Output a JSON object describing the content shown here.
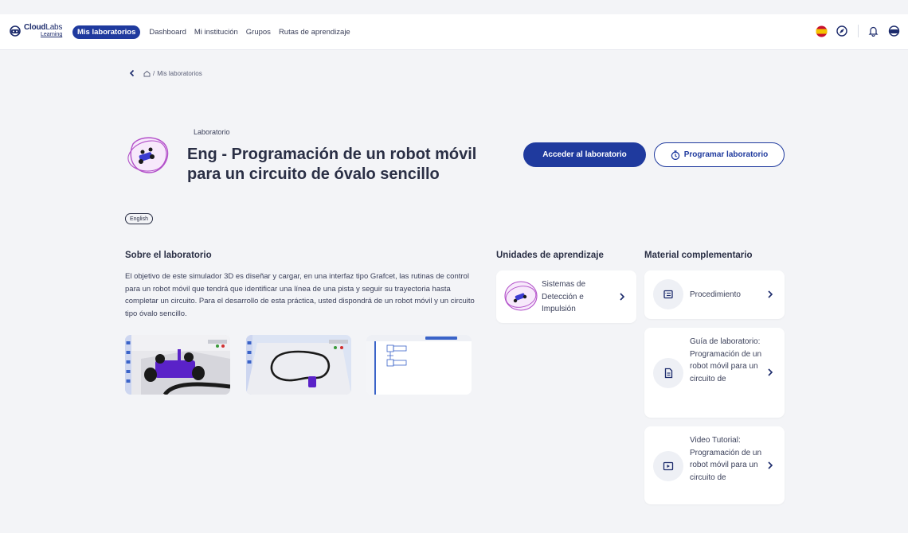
{
  "header": {
    "logo_main": "Cloud",
    "logo_accent": "Labs",
    "logo_sub": "Learning",
    "nav": [
      "Mis laboratorios",
      "Dashboard",
      "Mi institución",
      "Grupos",
      "Rutas de aprendizaje"
    ],
    "icons": [
      "spain-flag-icon",
      "compass-icon",
      "bell-icon",
      "robot-icon"
    ]
  },
  "breadcrumb": {
    "separator": "/",
    "current": "Mis laboratorios"
  },
  "lab": {
    "kicker": "Laboratorio",
    "title": "Eng - Programación de un robot móvil para un circuito de óvalo sencillo",
    "primary_button": "Acceder al laboratorio",
    "secondary_button": "Programar laboratorio",
    "tag": "English"
  },
  "about": {
    "heading": "Sobre el laboratorio",
    "text": "El objetivo de este simulador 3D es diseñar y cargar, en una interfaz tipo Grafcet, las rutinas de control para un robot móvil que tendrá que identificar una línea de una pista y seguir su trayectoria hasta completar un circuito. Para el desarrollo de esta práctica, usted dispondrá de un robot móvil y un circuito tipo óvalo sencillo."
  },
  "units": {
    "heading": "Unidades de aprendizaje",
    "items": [
      {
        "label": "Sistemas de Detección e Impulsión"
      }
    ]
  },
  "material": {
    "heading": "Material complementario",
    "items": [
      {
        "label": "Procedimiento",
        "icon": "procedure-icon"
      },
      {
        "label": "Guía de laboratorio: Programación de un robot móvil para un circuito de",
        "icon": "document-icon"
      },
      {
        "label": "Video Tutorial: Programación de un robot móvil para un circuito de",
        "icon": "video-icon"
      }
    ]
  },
  "colors": {
    "primary": "#1f3a9e",
    "accent": "#b24fc9",
    "background": "#f3f4f7"
  }
}
